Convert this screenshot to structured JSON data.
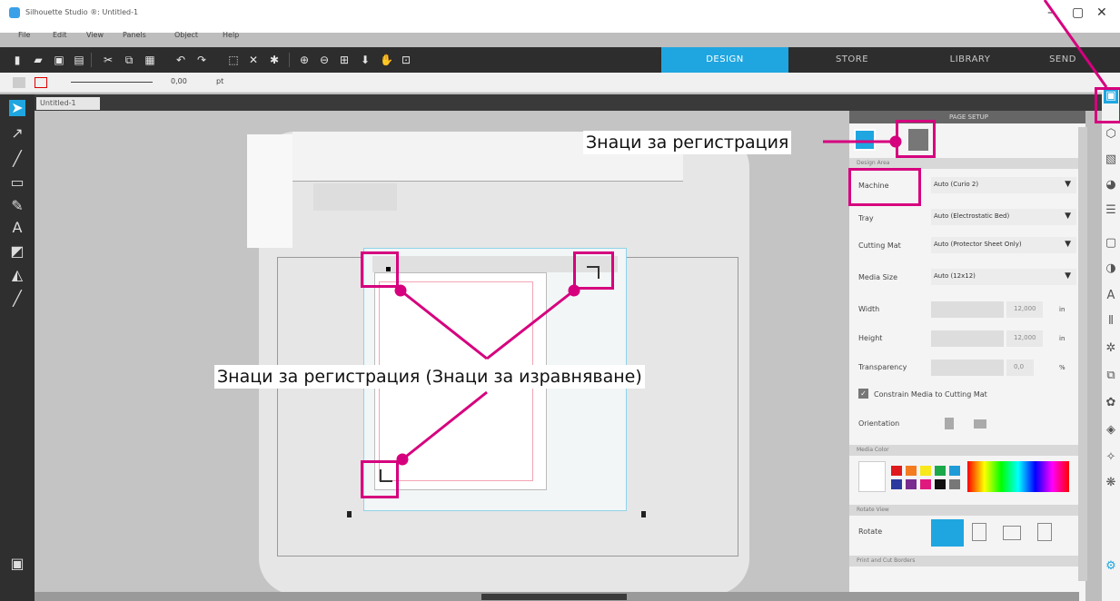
{
  "app": {
    "title": "Silhouette Studio ®: Untitled-1"
  },
  "window": {
    "minimize": "–",
    "maximize": "▢",
    "close": "✕"
  },
  "menu": [
    "File",
    "Edit",
    "View",
    "Panels",
    "Object",
    "Help"
  ],
  "nav_tabs": [
    {
      "label": "DESIGN",
      "active": true
    },
    {
      "label": "STORE",
      "active": false
    },
    {
      "label": "LIBRARY",
      "active": false
    },
    {
      "label": "SEND",
      "active": false
    }
  ],
  "line_bar": {
    "width_value": "0,00",
    "unit": "pt"
  },
  "document_tab": {
    "label": "Untitled-1"
  },
  "panel": {
    "header": "PAGE SETUP",
    "section_design_area": "Design Area",
    "rows": [
      {
        "label": "Machine",
        "value": "Auto (Curio 2)"
      },
      {
        "label": "Tray",
        "value": "Auto (Electrostatic Bed)"
      },
      {
        "label": "Cutting Mat",
        "value": "Auto (Protector Sheet Only)"
      },
      {
        "label": "Media Size",
        "value": "Auto (12x12)"
      }
    ],
    "width": {
      "label": "Width",
      "value": "12,000",
      "unit": "in"
    },
    "height": {
      "label": "Height",
      "value": "12,000",
      "unit": "in"
    },
    "transparency": {
      "label": "Transparency",
      "value": "0,0",
      "unit": "%"
    },
    "constrain": {
      "label": "Constrain Media to Cutting Mat",
      "checked": true
    },
    "orientation": {
      "label": "Orientation"
    },
    "section_media_color": "Media Color",
    "section_rotate": "Rotate View",
    "rotate": {
      "label": "Rotate"
    },
    "section_print_cut": "Print and Cut Borders"
  },
  "swatches": [
    "#e0191c",
    "#f47b20",
    "#f8e81c",
    "#1aa84a",
    "#1f9cd8",
    "#2b3a9e",
    "#7a2b90",
    "#e0197e",
    "#111111",
    "#777777"
  ],
  "annotations": {
    "top_label": "Знаци за регистрация",
    "middle_label": "Знаци за регистрация (Знаци за изравняване)"
  },
  "colors": {
    "accent": "#1fa6e0",
    "callout": "#d6007e"
  }
}
